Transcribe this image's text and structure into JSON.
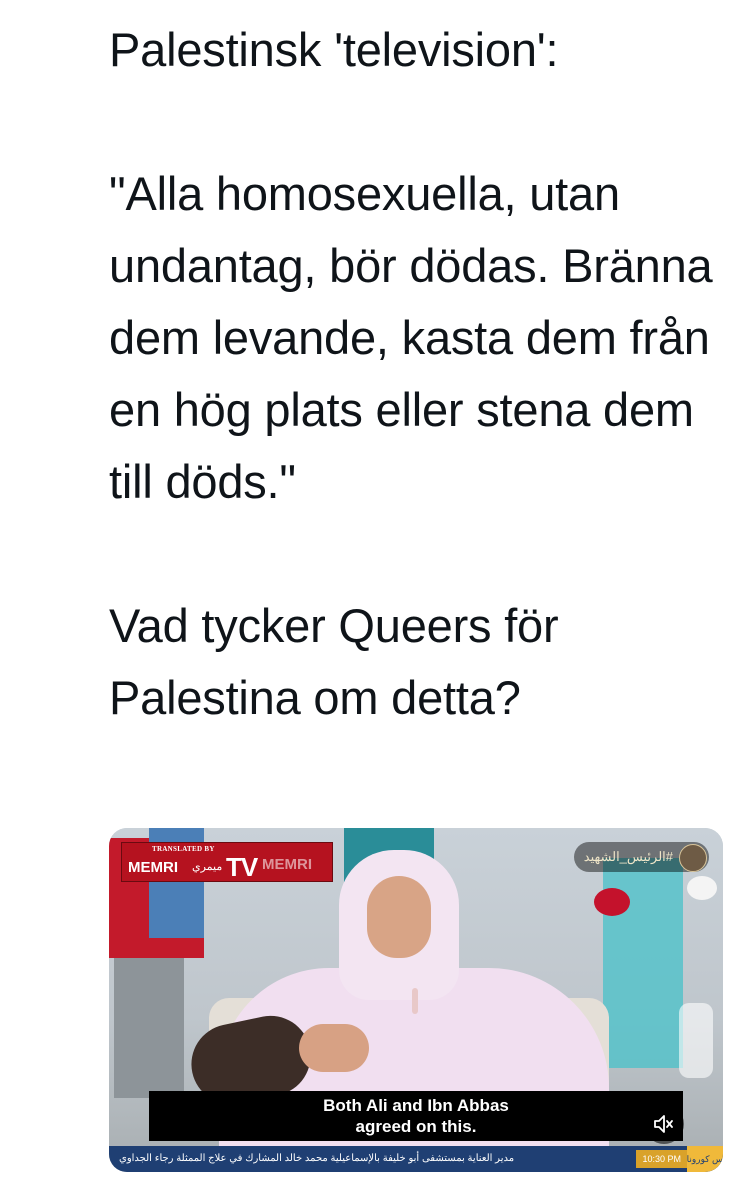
{
  "tweet": {
    "text": "Palestinsk 'television':\n\n\"Alla homosexuella, utan undantag, bör dödas. Bränna dem levande, kasta dem från en hög plats eller stena dem till döds.\"\n\nVad tycker Queers för Palestina om detta?"
  },
  "video": {
    "logo": {
      "top_text": "TRANSLATED BY",
      "memri": "MEMRI",
      "arabic": "ميمري",
      "tv": "TV",
      "right_text": "MEMRI"
    },
    "channel_badge": "#الرئيس_الشهيد",
    "subtitle": "Both Ali and Ibn Abbas\nagreed on this.",
    "mute_icon": "volume-muted-icon",
    "ticker": {
      "text": "مدير العناية بمستشفى أبو خليفة بالإسماعيلية محمد خالد المشارك في علاج الممثلة رجاء الجداوي",
      "time": "10:30 PM",
      "tag": "س كورونا"
    }
  },
  "colors": {
    "text": "#0f1419",
    "logo_red": "#b5121f",
    "ticker_blue": "#1f3f73",
    "ticker_gold": "#d9a22a"
  }
}
